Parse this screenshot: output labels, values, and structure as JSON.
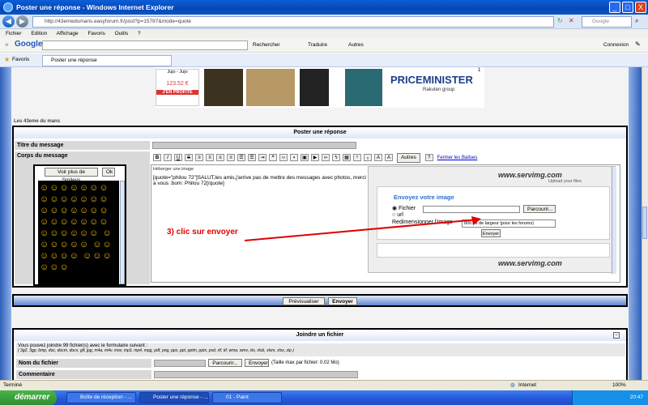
{
  "window": {
    "title": "Poster une réponse - Windows Internet Explorer",
    "minimize": "_",
    "maximize": "□",
    "close": "X"
  },
  "address": {
    "url": "http://43emedumans.easyforum.fr/post?p=15787&mode=quote",
    "search_placeholder": "Google"
  },
  "menu": [
    "Fichier",
    "Edition",
    "Affichage",
    "Favoris",
    "Outils",
    "?"
  ],
  "google_toolbar": {
    "logo": "Google",
    "search": "Rechercher",
    "translate": "Traduire",
    "others": "Autres",
    "login": "Connexion"
  },
  "favorites": {
    "label": "Favoris",
    "tab": "Poster une réponse"
  },
  "ads": {
    "jujo": "Jujo - Jujo",
    "jujo_price": "123.52 €",
    "jujo_cta": "J'EN PROFITE",
    "priceminister": "PRICEMINISTER",
    "rakuten": "Rakuten group",
    "ad_number": "1"
  },
  "forum": {
    "name": "Les 43eme du mans"
  },
  "post": {
    "header": "Poster une réponse",
    "title_label": "Titre du message",
    "body_label": "Corps du message",
    "smiley_select": "Voir plus de Smileys",
    "ok": "Ok",
    "other_btn": "Autres",
    "close_tags": "Fermer les Balises",
    "host_image": "Héberger une image",
    "body_text": "[quote=\"philou 72\"]SALUT,les amis,j'arrive pas de mettre des messages avec photos, merci a vous :bom: Philou 72[/quote]",
    "preview": "Prévisualiser",
    "send": "Envoyer"
  },
  "servimg": {
    "logo": "www.servimg.com",
    "tagline": "Upload your files",
    "heading": "Envoyez votre image",
    "file": "Fichier",
    "url": "url",
    "browse": "Parcourir...",
    "resize": "Redimensionner l'image",
    "resize_value": "800 px de largeur (pour les forums)",
    "send": "Envoyer"
  },
  "annotation": "3) clic sur envoyer",
  "attach": {
    "header": "Joindre un fichier",
    "info": "Vous pouvez joindre 99 fichier(s) avec le formulaire suivant :",
    "types": "( 3g2, 3gp, bmp, doc, docm, docx, gif, jpg, m4a, m4v, mov, mp3, mp4, mpg, pdf, png, pps, ppt, pptm, pptx, psd, rtf, tif, wma, wmv, xls, xlsb, xlsm, xlsx, zip )",
    "file_label": "Nom du fichier",
    "browse": "Parcourir...",
    "send": "Envoyer",
    "max_size": "(Taille max par fichier: 0.02 Mo)",
    "comment_label": "Commentaire"
  },
  "status": {
    "left": "Terminé",
    "zone": "Internet",
    "zoom": "100%"
  },
  "taskbar": {
    "start": "démarrer",
    "tasks": [
      "Boîte de réception - ...",
      "Poster une réponse - ...",
      "01 - Paint"
    ],
    "time": "20:47"
  }
}
